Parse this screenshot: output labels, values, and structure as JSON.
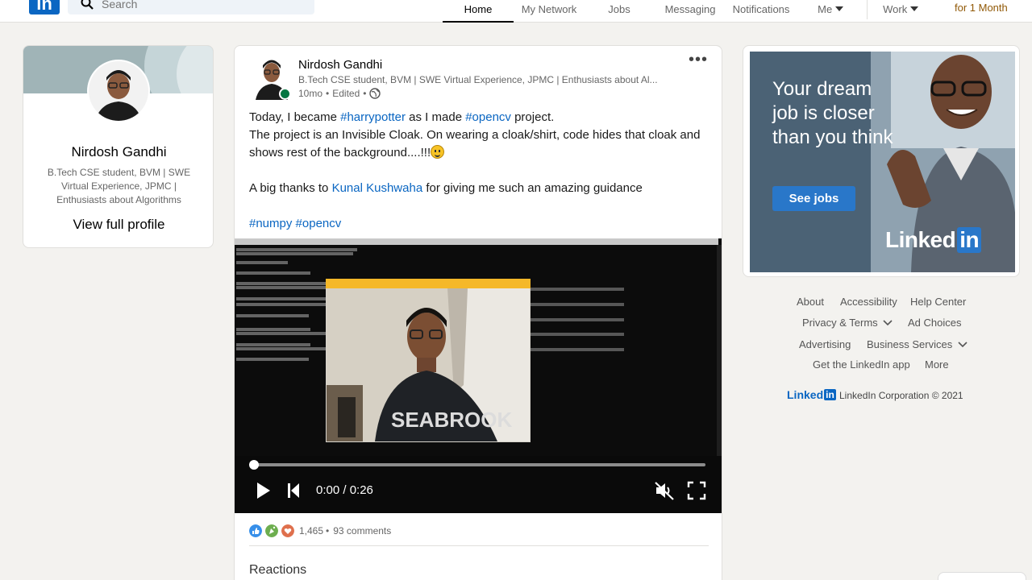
{
  "nav": {
    "search_placeholder": "Search",
    "items": [
      {
        "label": "Home",
        "icon": "home-icon",
        "active": true
      },
      {
        "label": "My Network",
        "icon": "network-icon"
      },
      {
        "label": "Jobs",
        "icon": "briefcase-icon"
      },
      {
        "label": "Messaging",
        "icon": "messaging-icon"
      },
      {
        "label": "Notifications",
        "icon": "bell-icon"
      },
      {
        "label": "Me",
        "icon": "avatar"
      },
      {
        "label": "Work",
        "icon": "grid-icon"
      }
    ],
    "premium_label": "for 1 Month"
  },
  "profile": {
    "name": "Nirdosh Gandhi",
    "headline": "B.Tech CSE student, BVM | SWE Virtual Experience, JPMC | Enthusiasts about Algorithms",
    "view_link": "View full profile"
  },
  "post": {
    "author": "Nirdosh Gandhi",
    "headline": "B.Tech CSE student, BVM | SWE Virtual Experience, JPMC | Enthusiasts about Al...",
    "time": "10mo",
    "edited": "Edited",
    "text": {
      "line1_before": "Today, I became ",
      "line1_tag1": "#harrypotter",
      "line1_mid": " as I made ",
      "line1_tag2": "#opencv",
      "line1_after": " project.",
      "line2": "The project is an Invisible Cloak. On wearing a cloak/shirt, code hides that cloak and shows rest of the background....!!!",
      "line3_before": "A big thanks to ",
      "line3_mention": "Kunal Kushwaha",
      "line3_after": " for giving me such an amazing guidance",
      "tag_numpy": "#numpy",
      "tag_opencv": "#opencv"
    },
    "video": {
      "time_display": "0:00 / 0:26",
      "progress": 0.0,
      "shirt_text": "SEABROOK",
      "muted": true
    },
    "reactions_count": "1,465",
    "comments_count": "93 comments",
    "reactions_heading": "Reactions"
  },
  "ad": {
    "headline": "Your dream job is closer than you think",
    "cta": "See jobs",
    "brand": "Linked",
    "brand_in": "in"
  },
  "footer": {
    "links": [
      "About",
      "Accessibility",
      "Help Center",
      "Privacy & Terms",
      "Ad Choices",
      "Advertising",
      "Business Services",
      "Get the LinkedIn app",
      "More"
    ],
    "brand": "Linked",
    "brand_in": "in",
    "copyright": "LinkedIn Corporation © 2021"
  },
  "colors": {
    "brand_blue": "#0a66c2",
    "background": "#f3f2ef",
    "online_green": "#057642",
    "premium_gold": "#915907"
  }
}
